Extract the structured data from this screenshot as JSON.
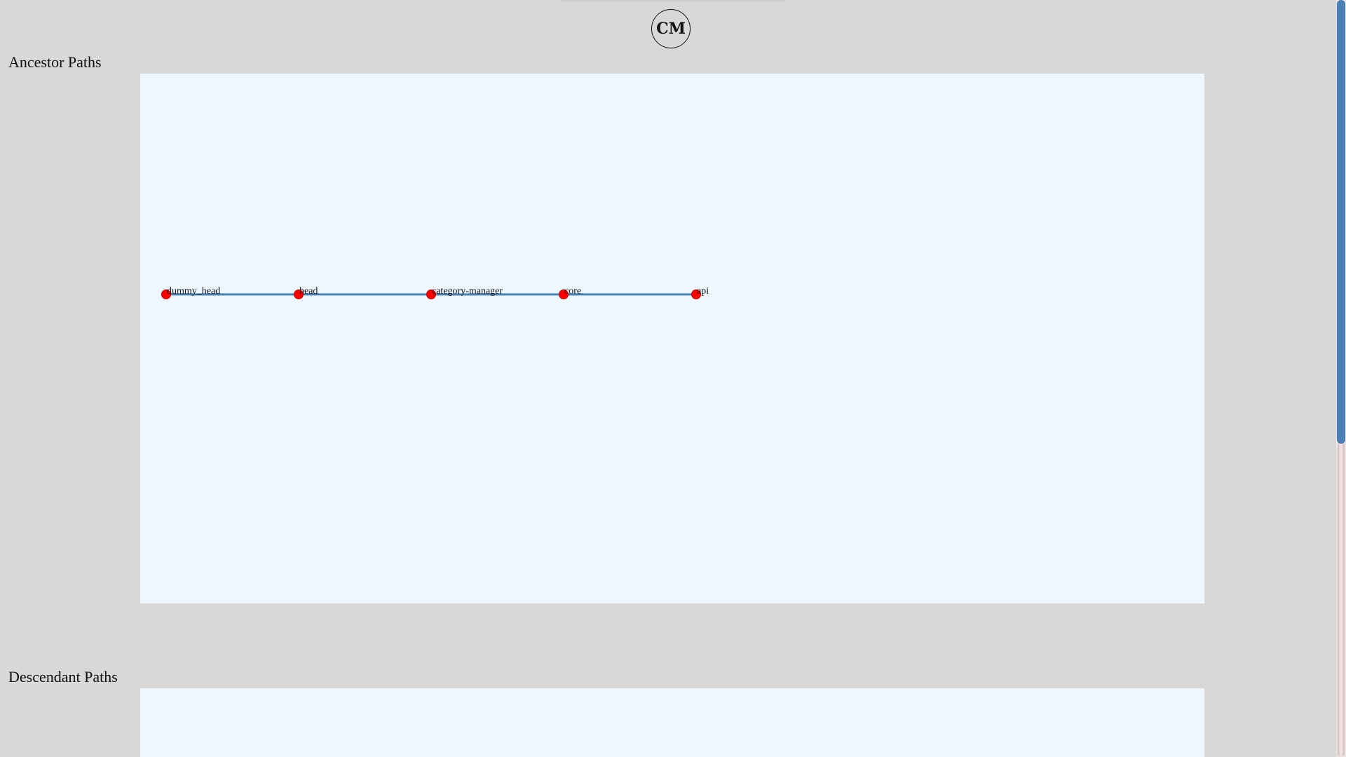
{
  "logo": {
    "text": "CM"
  },
  "ancestor": {
    "title": "Ancestor Paths",
    "nodes": [
      {
        "label": "dummy_head"
      },
      {
        "label": "head"
      },
      {
        "label": "category-manager"
      },
      {
        "label": "core"
      },
      {
        "label": "api"
      }
    ]
  },
  "descendant": {
    "title": "Descendant Paths"
  },
  "colors": {
    "node": "#ff0000",
    "edge": "#4682b4",
    "panel_bg": "#eef6fe",
    "page_bg": "#d8d8d8",
    "scroll_thumb": "#4a7fb5"
  }
}
